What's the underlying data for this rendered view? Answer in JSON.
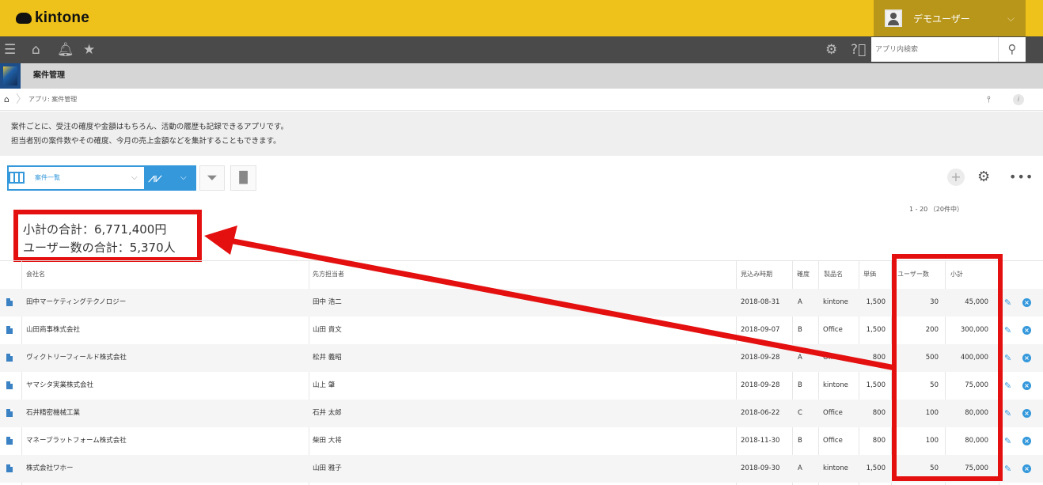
{
  "header": {
    "logo_text": "kintone",
    "user_name": "デモユーザー"
  },
  "toolbar": {
    "menu_icon": "menu-icon",
    "home_icon": "home-icon",
    "bell_icon": "bell-icon",
    "star_icon": "star-icon",
    "settings_icon": "gear-icon",
    "help_icon": "help-icon",
    "search_placeholder": "アプリ内検索"
  },
  "app": {
    "title": "案件管理"
  },
  "breadcrumb": {
    "text": "アプリ: 案件管理"
  },
  "description": {
    "line1": "案件ごとに、受注の確度や金額はもちろん、活動の履歴も記録できるアプリです。",
    "line2": "担当者別の案件数やその確度、今月の売上金額などを集計することもできます。"
  },
  "view": {
    "selected": "案件一覧"
  },
  "pager": "1 - 20 （20件中）",
  "totals": {
    "subtotal": "小計の合計：6,771,400円",
    "users": "ユーザー数の合計：5,370人"
  },
  "table": {
    "headers": {
      "company": "会社名",
      "contact": "先方担当者",
      "date": "見込み時期",
      "certainty": "確度",
      "product": "製品名",
      "price": "単価",
      "users": "ユーザー数",
      "subtotal": "小計"
    },
    "rows": [
      {
        "company": "田中マーケティングテクノロジー",
        "contact": "田中 浩二",
        "date": "2018-08-31",
        "certainty": "A",
        "product": "kintone",
        "price": "1,500",
        "users": "30",
        "subtotal": "45,000"
      },
      {
        "company": "山田商事株式会社",
        "contact": "山田 貴文",
        "date": "2018-09-07",
        "certainty": "B",
        "product": "Office",
        "price": "1,500",
        "users": "200",
        "subtotal": "300,000"
      },
      {
        "company": "ヴィクトリーフィールド株式会社",
        "contact": "松井 義昭",
        "date": "2018-09-28",
        "certainty": "A",
        "product": "Office",
        "price": "800",
        "users": "500",
        "subtotal": "400,000"
      },
      {
        "company": "ヤマシタ実業株式会社",
        "contact": "山上 肇",
        "date": "2018-09-28",
        "certainty": "B",
        "product": "kintone",
        "price": "1,500",
        "users": "50",
        "subtotal": "75,000"
      },
      {
        "company": "石井精密機械工業",
        "contact": "石井 太郎",
        "date": "2018-06-22",
        "certainty": "C",
        "product": "Office",
        "price": "800",
        "users": "100",
        "subtotal": "80,000"
      },
      {
        "company": "マネープラットフォーム株式会社",
        "contact": "柴田 大将",
        "date": "2018-11-30",
        "certainty": "B",
        "product": "Office",
        "price": "800",
        "users": "100",
        "subtotal": "80,000"
      },
      {
        "company": "株式会社ワホー",
        "contact": "山田 雅子",
        "date": "2018-09-30",
        "certainty": "A",
        "product": "kintone",
        "price": "1,500",
        "users": "50",
        "subtotal": "75,000"
      }
    ]
  },
  "annotation_color": "#e41010"
}
